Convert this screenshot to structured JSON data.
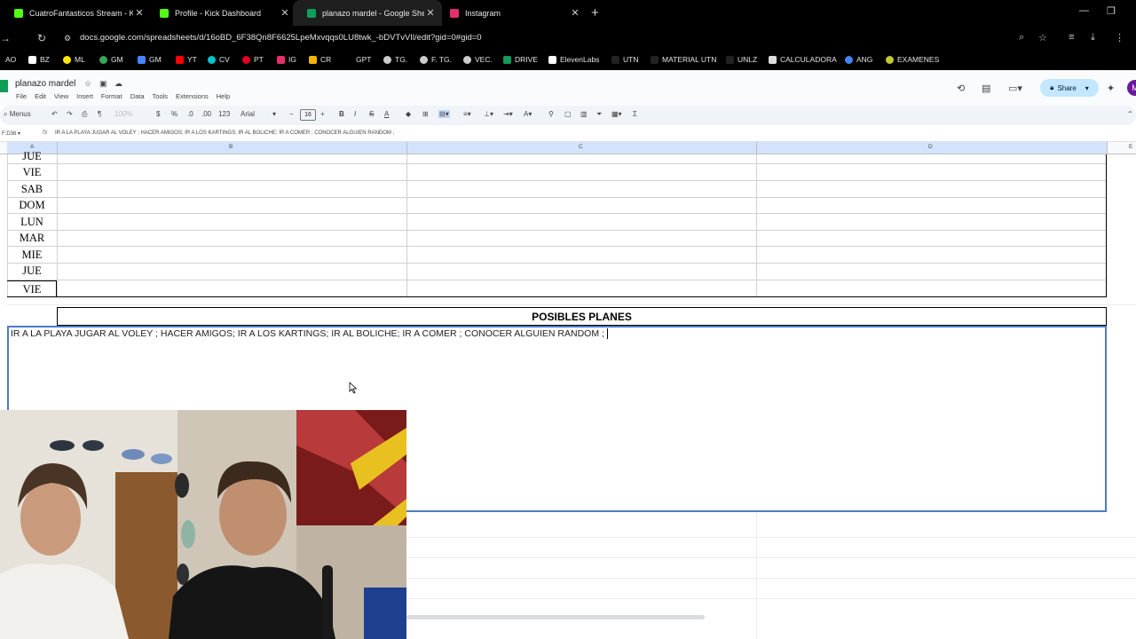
{
  "browser": {
    "tabs": [
      {
        "title": "CuatroFantasticos Stream - Kick",
        "favicon_color": "#53fc18",
        "active": false
      },
      {
        "title": "Profile - Kick Dashboard",
        "favicon_color": "#53fc18",
        "active": false
      },
      {
        "title": "planazo mardel - Google Sheets",
        "favicon_color": "#0f9d58",
        "active": true
      },
      {
        "title": "Instagram",
        "favicon_color": "#e1306c",
        "active": false
      }
    ],
    "url": "docs.google.com/spreadsheets/d/16oBD_6F38Qn8F6625LpeMxvqqs0LU8twk_-bDVTvVIl/edit?gid=0#gid=0",
    "bookmarks": [
      "AO",
      "BZ",
      "ML",
      "GM",
      "GM",
      "YT",
      "CV",
      "PT",
      "IG",
      "CR",
      "GPT",
      "TG.",
      "F. TG.",
      "VEC.",
      "DRIVE",
      "ElevenLabs",
      "UTN",
      "MATERIAL UTN",
      "UNLZ",
      "CALCULADORA",
      "ANG",
      "EXAMENES"
    ]
  },
  "sheets": {
    "title": "planazo mardel",
    "menus": [
      "File",
      "Edit",
      "View",
      "Insert",
      "Format",
      "Data",
      "Tools",
      "Extensions",
      "Help"
    ],
    "share_label": "Share",
    "avatar_letter": "M",
    "toolbar": {
      "search": "Menus",
      "zoom": "100%",
      "currency": "$",
      "percent": "%",
      "number_format": "123",
      "font": "Arial",
      "font_size": "16"
    },
    "name_box": "F:D36",
    "formula": "IR A LA PLAYA JUGAR AL VOLEY ; HACER AMIGOS; IR A LOS KARTINGS; IR AL BOLICHE; IR A COMER ; CONOCER ALGUIEN RANDOM ;",
    "columns": [
      "A",
      "B",
      "C",
      "D",
      "E"
    ],
    "days": [
      "JUE",
      "VIE",
      "SAB",
      "DOM",
      "LUN",
      "MAR",
      "MIE",
      "JUE",
      "VIE"
    ],
    "section_title": "POSIBLES PLANES",
    "section_text": "IR A LA PLAYA JUGAR AL VOLEY ; HACER AMIGOS; IR A LOS KARTINGS; IR AL BOLICHE; IR A COMER ; CONOCER ALGUIEN RANDOM ;"
  }
}
